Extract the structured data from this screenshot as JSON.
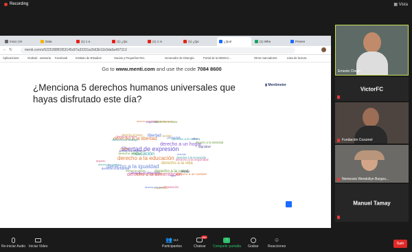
{
  "zoom": {
    "recording_label": "Recording",
    "view_label": "Vista",
    "participants_count": "113"
  },
  "browser": {
    "tabs": [
      "Inicio | M",
      "Data",
      "(1) 1 a",
      "(1) ¿Qu",
      "(1) 1 si",
      "(1) ¿Qu",
      "¿Qué",
      "(1) Wha",
      "Presen"
    ],
    "url": "menti.com/s/5225288f0353145c87a33331a2b63b11b3da9a497313",
    "bookmarks": [
      "Aplicaciones",
      "Outlook - asesoria",
      "Facebook",
      "Instituto de Estudios",
      "Hacias y Pequeños Ret.",
      "Generador de Disergía",
      "Portal de la DEMAC...",
      "Otros marcadores",
      "Lista de lectura"
    ]
  },
  "slide": {
    "code_prefix": "Go to",
    "code_site": "www.menti.com",
    "code_mid": "and use the code",
    "code_value": "7084 8600",
    "question": "¿Menciona 5 derechos humanos universales que hayas disfrutado este día?",
    "logo": "Mentimeter"
  },
  "cloud_words": [
    "libertad de expresión",
    "derecho a la educación",
    "derecho a un hogar",
    "derecho a la igualdad",
    "derecho a la alimentación",
    "derecho a la libertad",
    "educación",
    "libertad",
    "derecho a la vida",
    "derecho a la salud",
    "vivienda",
    "derecho a la vivienda",
    "derecho al trabajo",
    "salud",
    "alimentación",
    "derecho al agua",
    "igualdad",
    "trabajo",
    "derecho a la familia",
    "derecho a la libertad de expresión",
    "derecho a la recreación",
    "derecho al descanso",
    "libertad de religión",
    "derecho a la identidad",
    "expresión",
    "derecho a la información",
    "privacidad",
    "derecho a un nombre",
    "derecho a la justicia",
    "seguridad",
    "derecho a la seguridad",
    "libertad de tránsito",
    "derecho al juego",
    "dignidad",
    "derecho a la paz",
    "vestido",
    "derecho a la cultura",
    "agua",
    "respeto",
    "derecho a votar"
  ],
  "participants": [
    {
      "name": "Ernesto Chejin",
      "type": "video"
    },
    {
      "name": "VictorFC",
      "type": "name"
    },
    {
      "name": "Fundación Cozumel",
      "type": "video"
    },
    {
      "name": "Nemessis Wendollyn Burgos...",
      "type": "video"
    },
    {
      "name": "Manuel Tamay",
      "type": "name"
    }
  ],
  "toolbar": {
    "unmute": "Re-iniciar Audio",
    "video": "Iniciar Video",
    "participants": "Participantes",
    "chat": "Chatear",
    "chat_badge": "186",
    "share": "Compartir pantalla",
    "record": "Grabar",
    "reactions": "Reacciones",
    "leave": "Salir"
  }
}
